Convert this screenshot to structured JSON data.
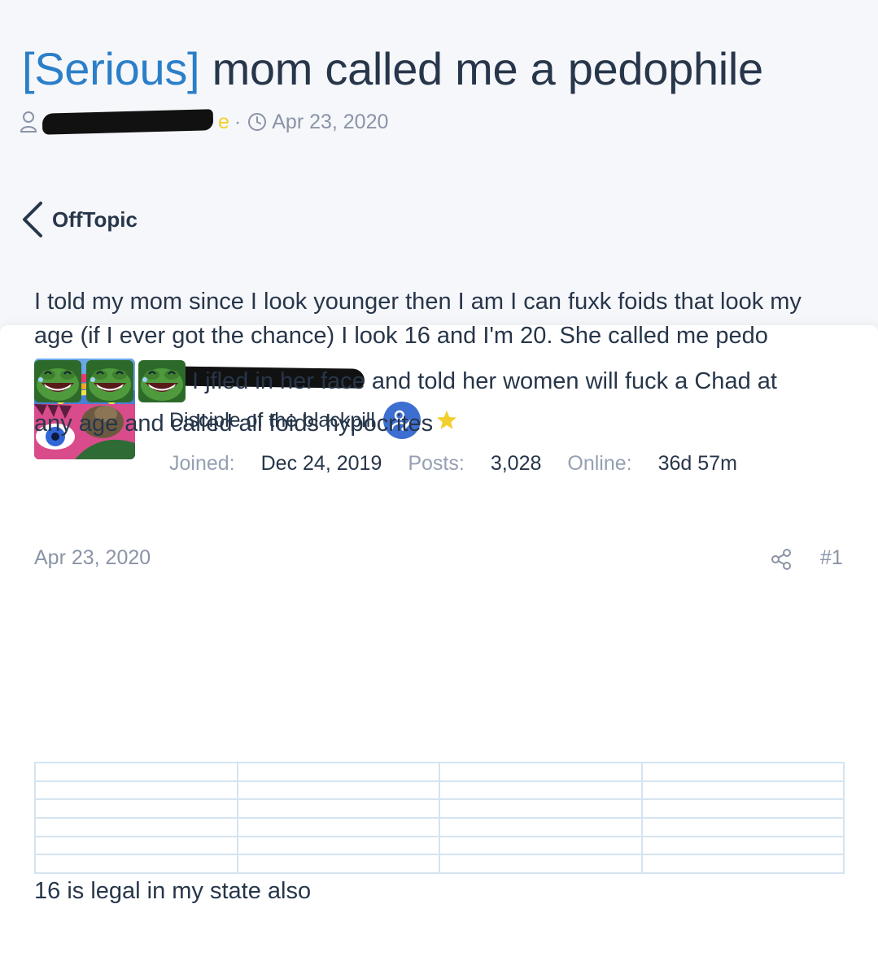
{
  "thread": {
    "prefix": "[Serious]",
    "title": "mom called me a pedophile",
    "date": "Apr 23, 2020",
    "author_visible": "e",
    "meta_separator": "·"
  },
  "breadcrumb": {
    "forum_label": "OffTopic"
  },
  "user": {
    "user_title": "Disciple of the blackpill",
    "stats": [
      {
        "key": "Joined:",
        "value": "Dec 24, 2019"
      },
      {
        "key": "Posts:",
        "value": "3,028"
      },
      {
        "key": "Online:",
        "value": "36d 57m"
      }
    ]
  },
  "post": {
    "date": "Apr 23, 2020",
    "number": "#1",
    "line1": "I told my mom since I look younger then I am I can fuxk foids that look my",
    "line2": "age (if I ever got the chance) I look 16 and I'm 20. She called me pedo",
    "line3": "I jfled in her face and told her women will fuck a Chad at",
    "line4": "any age and called all foids hypocrites",
    "footer": "16 is legal in my state also",
    "emojis": [
      "laughing-pepe-icon",
      "laughing-pepe-icon",
      "laughing-pepe-icon"
    ]
  },
  "colors": {
    "prefix": "#2b7fc8",
    "title": "#27364a",
    "muted": "#8a94a6",
    "badge": "#3d6fd1",
    "star": "#f2cf2e",
    "table_border": "#d4e4f1"
  }
}
